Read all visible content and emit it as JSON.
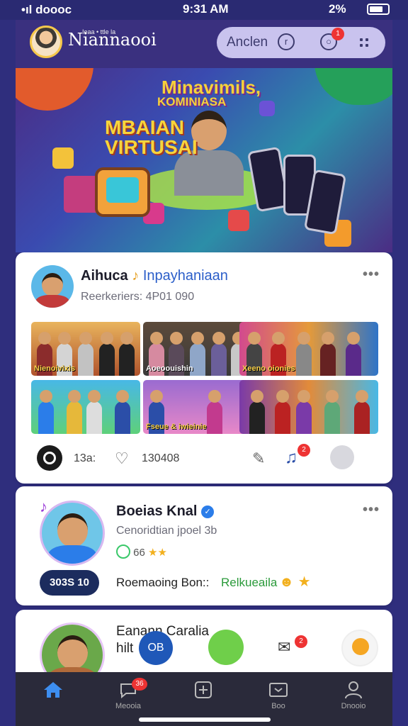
{
  "status_bar": {
    "carrier": "•ıl doooc",
    "time": "9:31 AM",
    "battery": "2%"
  },
  "header": {
    "brand": "Niannaooi",
    "brand_sup": "Ieaa • ttle la",
    "search_label": "Anclen",
    "notif_count": "1"
  },
  "banner": {
    "title_line1": "Minavimils,",
    "title_line2": "KOMINIASA",
    "title_line3a": "MBAIAN",
    "title_line3b": "VIRTUSAI"
  },
  "post1": {
    "name": "Aihuca",
    "tag": "Inpayhaniaan",
    "subtitle": "Reerkeriers: 4P01 090",
    "photos": [
      {
        "caption": "Nienoivixis"
      },
      {
        "caption": "Aoeoouishin"
      },
      {
        "caption": "Xeeno oionies"
      },
      {
        "caption": ""
      },
      {
        "caption": "Fseue & iwieinie"
      },
      {
        "caption": ""
      }
    ],
    "actions": {
      "count_a": "13a:",
      "count_b": "130408",
      "notif_badge": "2"
    }
  },
  "post2": {
    "name": "Boeias Knal",
    "subtitle": "Cenoridtian jpoel 3b",
    "badge_text": "66",
    "pill": "303S 10",
    "footer_label": "Roemaoing Bon::",
    "footer_highlight": "Relkueaila"
  },
  "post3": {
    "name_line1": "Eanann Caralia",
    "name_line2": "hilt",
    "dm_badge": "2"
  },
  "bottom_nav": {
    "items": [
      {
        "label": "",
        "icon": "home-icon"
      },
      {
        "label": "Meooia",
        "icon": "chat-icon",
        "badge": "36"
      },
      {
        "label": "",
        "icon": "add-icon"
      },
      {
        "label": "Boo",
        "icon": "inbox-icon"
      },
      {
        "label": "Dnooio",
        "icon": "profile-icon"
      }
    ]
  },
  "colors": {
    "accent": "#2b7de9",
    "header_bg": "#3a307f",
    "nav_bg": "#2a2a3a",
    "badge": "#e33333"
  }
}
